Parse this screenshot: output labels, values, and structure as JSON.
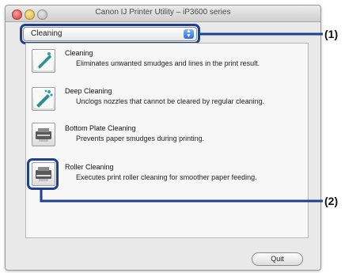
{
  "window": {
    "title": "Canon IJ Printer Utility – iP3600 series"
  },
  "maintenance_popup": {
    "selected": "Cleaning"
  },
  "items": [
    {
      "title": "Cleaning",
      "description": "Eliminates unwanted smudges and lines in the print result.",
      "icon": "print-head-cleaning-icon"
    },
    {
      "title": "Deep Cleaning",
      "description": "Unclogs nozzles that cannot be cleared by regular cleaning.",
      "icon": "deep-cleaning-icon"
    },
    {
      "title": "Bottom Plate Cleaning",
      "description": "Prevents paper smudges during printing.",
      "icon": "bottom-plate-icon"
    },
    {
      "title": "Roller Cleaning",
      "description": "Executes print roller cleaning for smoother paper feeding.",
      "icon": "roller-icon"
    }
  ],
  "quit_button": {
    "label": "Quit"
  },
  "callouts": {
    "c1": "(1)",
    "c2": "(2)"
  },
  "colors": {
    "callout": "#1f3f8f",
    "popup_arrow": "#2f6fd6"
  }
}
